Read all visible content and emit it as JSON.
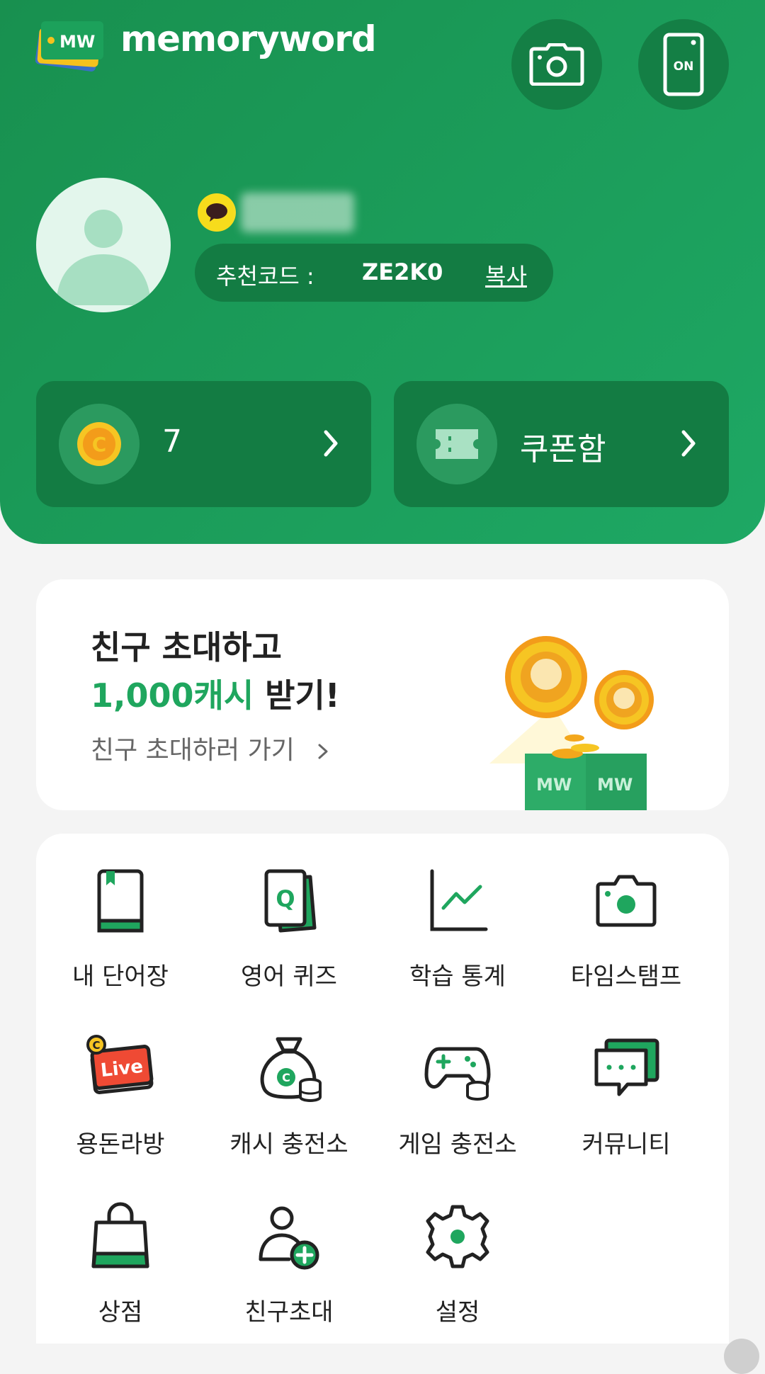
{
  "app": {
    "brand": "memoryword",
    "logo_text": "MW"
  },
  "header": {
    "camera_button": "camera-icon",
    "phone_button_label": "ON"
  },
  "profile": {
    "referral_label": "추천코드 :",
    "referral_code": "ZE2K0",
    "copy_label": "복사"
  },
  "cards": {
    "cash_count": "7",
    "coupon_label": "쿠폰함"
  },
  "invite_banner": {
    "line1": "친구 초대하고",
    "highlight": "1,000캐시",
    "line2_rest": " 받기!",
    "link": "친구 초대하러 가기",
    "box_label": "MW"
  },
  "menu": {
    "items": [
      {
        "label": "내 단어장",
        "icon": "book-icon"
      },
      {
        "label": "영어 퀴즈",
        "icon": "quiz-card-icon"
      },
      {
        "label": "학습 통계",
        "icon": "line-chart-icon"
      },
      {
        "label": "타임스탬프",
        "icon": "camera-icon"
      },
      {
        "label": "용돈라방",
        "icon": "live-icon",
        "badge": "Live"
      },
      {
        "label": "캐시 충전소",
        "icon": "money-bag-icon"
      },
      {
        "label": "게임 충전소",
        "icon": "gamepad-icon"
      },
      {
        "label": "커뮤니티",
        "icon": "chat-bubble-icon"
      },
      {
        "label": "상점",
        "icon": "shopping-bag-icon"
      },
      {
        "label": "친구초대",
        "icon": "add-user-icon"
      },
      {
        "label": "설정",
        "icon": "gear-icon"
      }
    ]
  },
  "colors": {
    "primary_green": "#1ea864",
    "dark_green": "#137c43",
    "accent_yellow": "#f7c21f",
    "text_dark": "#222222"
  }
}
